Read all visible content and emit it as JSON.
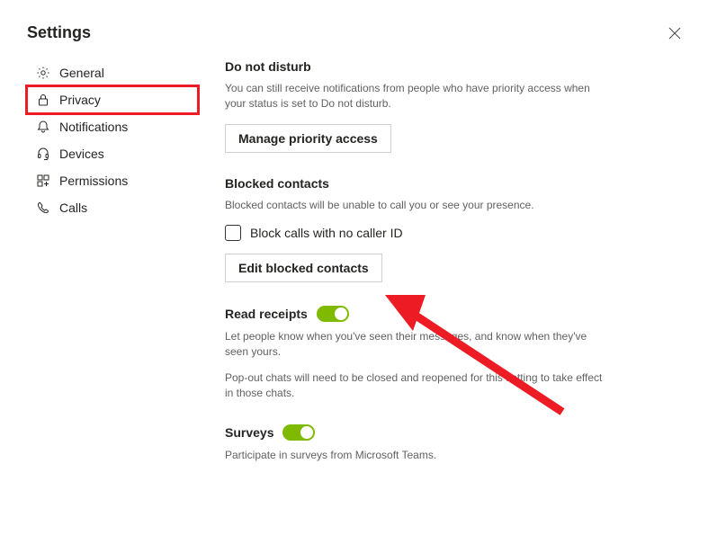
{
  "header": {
    "title": "Settings"
  },
  "sidebar": {
    "items": [
      {
        "label": "General"
      },
      {
        "label": "Privacy"
      },
      {
        "label": "Notifications"
      },
      {
        "label": "Devices"
      },
      {
        "label": "Permissions"
      },
      {
        "label": "Calls"
      }
    ]
  },
  "sections": {
    "dnd": {
      "title": "Do not disturb",
      "desc": "You can still receive notifications from people who have priority access when your status is set to Do not disturb.",
      "button": "Manage priority access"
    },
    "blocked": {
      "title": "Blocked contacts",
      "desc": "Blocked contacts will be unable to call you or see your presence.",
      "checkbox": "Block calls with no caller ID",
      "button": "Edit blocked contacts"
    },
    "read": {
      "title": "Read receipts",
      "desc1": "Let people know when you've seen their messages, and know when they've seen yours.",
      "desc2": "Pop-out chats will need to be closed and reopened for this setting to take effect in those chats."
    },
    "surveys": {
      "title": "Surveys",
      "desc": "Participate in surveys from Microsoft Teams."
    }
  }
}
